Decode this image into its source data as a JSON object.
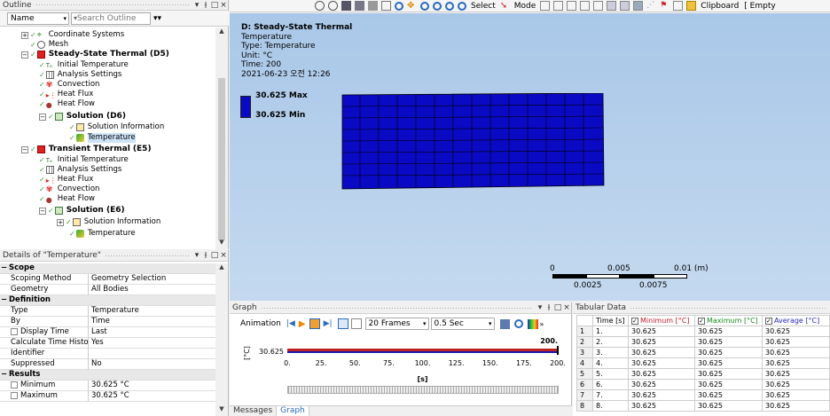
{
  "outline": {
    "title": "Outline",
    "name_label": "Name",
    "search_placeholder": "Search Outline",
    "items": [
      {
        "label": "Coordinate Systems"
      },
      {
        "label": "Mesh"
      },
      {
        "label": "Steady-State Thermal (D5)"
      },
      {
        "label": "Initial Temperature"
      },
      {
        "label": "Analysis Settings"
      },
      {
        "label": "Convection"
      },
      {
        "label": "Heat Flux"
      },
      {
        "label": "Heat Flow"
      },
      {
        "label": "Solution (D6)"
      },
      {
        "label": "Solution Information"
      },
      {
        "label": "Temperature"
      },
      {
        "label": "Transient Thermal (E5)"
      },
      {
        "label": "Initial Temperature"
      },
      {
        "label": "Analysis Settings"
      },
      {
        "label": "Heat Flux"
      },
      {
        "label": "Convection"
      },
      {
        "label": "Heat Flow"
      },
      {
        "label": "Solution (E6)"
      },
      {
        "label": "Solution Information"
      },
      {
        "label": "Temperature"
      }
    ],
    "minus": "−",
    "plus": "+",
    "check": "✓"
  },
  "details": {
    "title": "Details of \"Temperature\"",
    "rows": [
      {
        "label": "Scope"
      },
      {
        "label": "Scoping Method",
        "value": "Geometry Selection"
      },
      {
        "label": "Geometry",
        "value": "All Bodies"
      },
      {
        "label": "Definition"
      },
      {
        "label": "Type",
        "value": "Temperature"
      },
      {
        "label": "By",
        "value": "Time"
      },
      {
        "label": "Display Time",
        "value": "Last"
      },
      {
        "label": "Calculate Time History",
        "value": "Yes"
      },
      {
        "label": "Identifier",
        "value": ""
      },
      {
        "label": "Suppressed",
        "value": "No"
      },
      {
        "label": "Results"
      },
      {
        "label": "Minimum",
        "value": "30.625 °C"
      },
      {
        "label": "Maximum",
        "value": "30.625 °C"
      }
    ],
    "collapse": "−"
  },
  "panel_ctl": {
    "pin": "▾",
    "dock": "⫲",
    "max": "□",
    "close": "×"
  },
  "toolbar": {
    "select": "Select",
    "mode": "Mode",
    "clipboard": "Clipboard",
    "empty": "[ Empty"
  },
  "viewport": {
    "heading": "D: Steady-State Thermal",
    "line1": "Temperature",
    "line2": "Type: Temperature",
    "line3": "Unit: °C",
    "line4": "Time: 200",
    "line5": "2021-06-23 오전 12:26",
    "legend_max": "30.625 Max",
    "legend_min": "30.625 Min",
    "scale_labels": [
      "0",
      "0.005",
      "0.01 (m)"
    ],
    "scale_sub": [
      "0.0025",
      "0.0075"
    ],
    "mesh_color": "#0a0ac4",
    "bg_color": "#a9c7e8"
  },
  "graph": {
    "title": "Graph",
    "animation": "Animation",
    "frames": "20 Frames",
    "speed": "0.5 Sec",
    "y_unit": "[°C]",
    "top_value": "200.",
    "x_unit": "[s]"
  },
  "chart_data": {
    "type": "line",
    "x": [
      0,
      25,
      50,
      75,
      100,
      125,
      150,
      175,
      200
    ],
    "series": [
      {
        "values": [
          30.625,
          30.625,
          30.625,
          30.625,
          30.625,
          30.625,
          30.625,
          30.625,
          30.625
        ],
        "color": "#1a1ab0"
      }
    ],
    "xticks": [
      "0.",
      "25.",
      "50.",
      "75.",
      "100.",
      "125.",
      "150.",
      "175.",
      "200."
    ],
    "yticks": [
      "30.625"
    ],
    "xlabel": "[s]",
    "ylabel": "[°C]",
    "xlim": [
      0,
      200
    ]
  },
  "bottom_tabs": {
    "messages": "Messages",
    "graph": "Graph"
  },
  "tabular": {
    "title": "Tabular Data",
    "headers": [
      "Time [s]",
      "Minimum [°C]",
      "Maximum [°C]",
      "Average [°C]"
    ],
    "header_colors": [
      "#000000",
      "#c0202a",
      "#1e8a1e",
      "#2a2ac0"
    ],
    "rows": [
      [
        "1",
        "1.",
        "30.625",
        "30.625",
        "30.625"
      ],
      [
        "2",
        "2.",
        "30.625",
        "30.625",
        "30.625"
      ],
      [
        "3",
        "3.",
        "30.625",
        "30.625",
        "30.625"
      ],
      [
        "4",
        "4.",
        "30.625",
        "30.625",
        "30.625"
      ],
      [
        "5",
        "5.",
        "30.625",
        "30.625",
        "30.625"
      ],
      [
        "6",
        "6.",
        "30.625",
        "30.625",
        "30.625"
      ],
      [
        "7",
        "7.",
        "30.625",
        "30.625",
        "30.625"
      ],
      [
        "8",
        "8.",
        "30.625",
        "30.625",
        "30.625"
      ]
    ]
  }
}
